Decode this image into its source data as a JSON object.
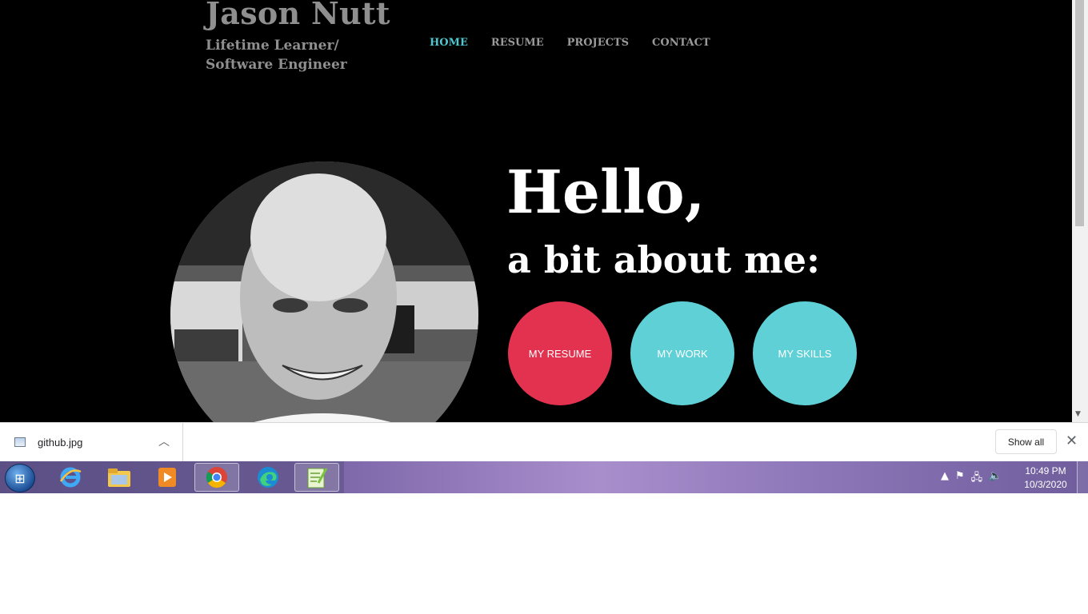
{
  "site": {
    "title": "Jason Nutt",
    "tagline": "Lifetime Learner/ Software Engineer"
  },
  "nav": {
    "items": [
      {
        "label": "HOME",
        "active": true
      },
      {
        "label": "RESUME",
        "active": false
      },
      {
        "label": "PROJECTS",
        "active": false
      },
      {
        "label": "CONTACT",
        "active": false
      }
    ]
  },
  "hero": {
    "greeting": "Hello,",
    "subheading": "a bit about me:",
    "buttons": [
      {
        "label": "MY RESUME",
        "color": "#e3324f"
      },
      {
        "label": "MY WORK",
        "color": "#5ed0d6"
      },
      {
        "label": "MY SKILLS",
        "color": "#5ed0d6"
      }
    ]
  },
  "download_bar": {
    "file_name": "github.jpg",
    "show_all_label": "Show all"
  },
  "taskbar": {
    "apps": [
      "windows-start-icon",
      "internet-explorer-icon",
      "file-explorer-icon",
      "media-player-icon",
      "chrome-icon",
      "edge-icon",
      "notepad-plus-plus-icon"
    ],
    "clock": {
      "time": "10:49 PM",
      "date": "10/3/2020"
    }
  },
  "colors": {
    "accent_cyan": "#5ed0d6",
    "accent_red": "#e3324f",
    "nav_active": "#4fc7d0",
    "background": "#000000"
  }
}
